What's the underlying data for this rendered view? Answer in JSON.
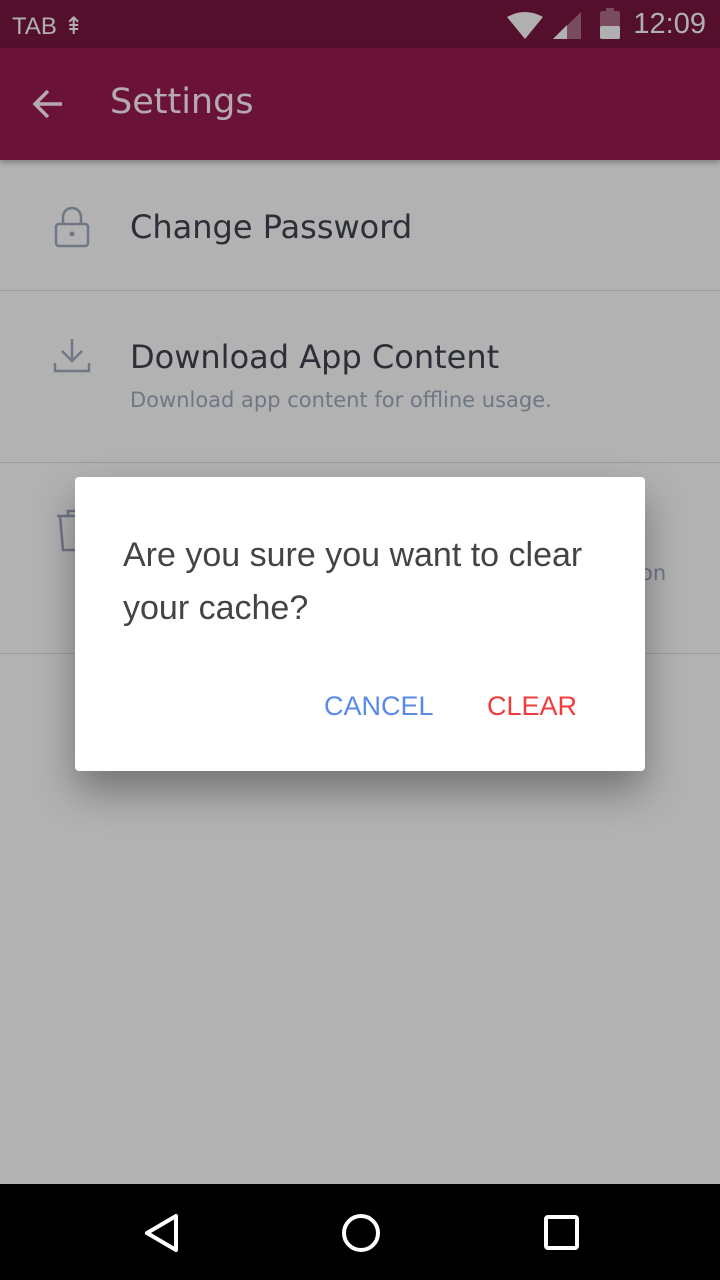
{
  "status_bar": {
    "carrier": "TAB",
    "time": "12:09",
    "icons": [
      "network-icon",
      "wifi-icon",
      "signal-icon",
      "battery-icon"
    ]
  },
  "app_bar": {
    "title": "Settings",
    "back_icon": "arrow-left-icon"
  },
  "settings": [
    {
      "title": "Change Password",
      "icon": "lock-icon"
    },
    {
      "title": "Download App Content",
      "subtitle": "Download app content for offline usage.",
      "icon": "download-icon"
    },
    {
      "icon": "trash-icon",
      "subtitle_fragment": "on"
    }
  ],
  "dialog": {
    "message": "Are you sure you want to clear your cache?",
    "cancel_label": "CANCEL",
    "clear_label": "CLEAR",
    "cancel_color": "#5a8ae8",
    "clear_color": "#f23c3c"
  },
  "nav_bar": {
    "icons": [
      "back-triangle-icon",
      "home-circle-icon",
      "recents-square-icon"
    ]
  }
}
